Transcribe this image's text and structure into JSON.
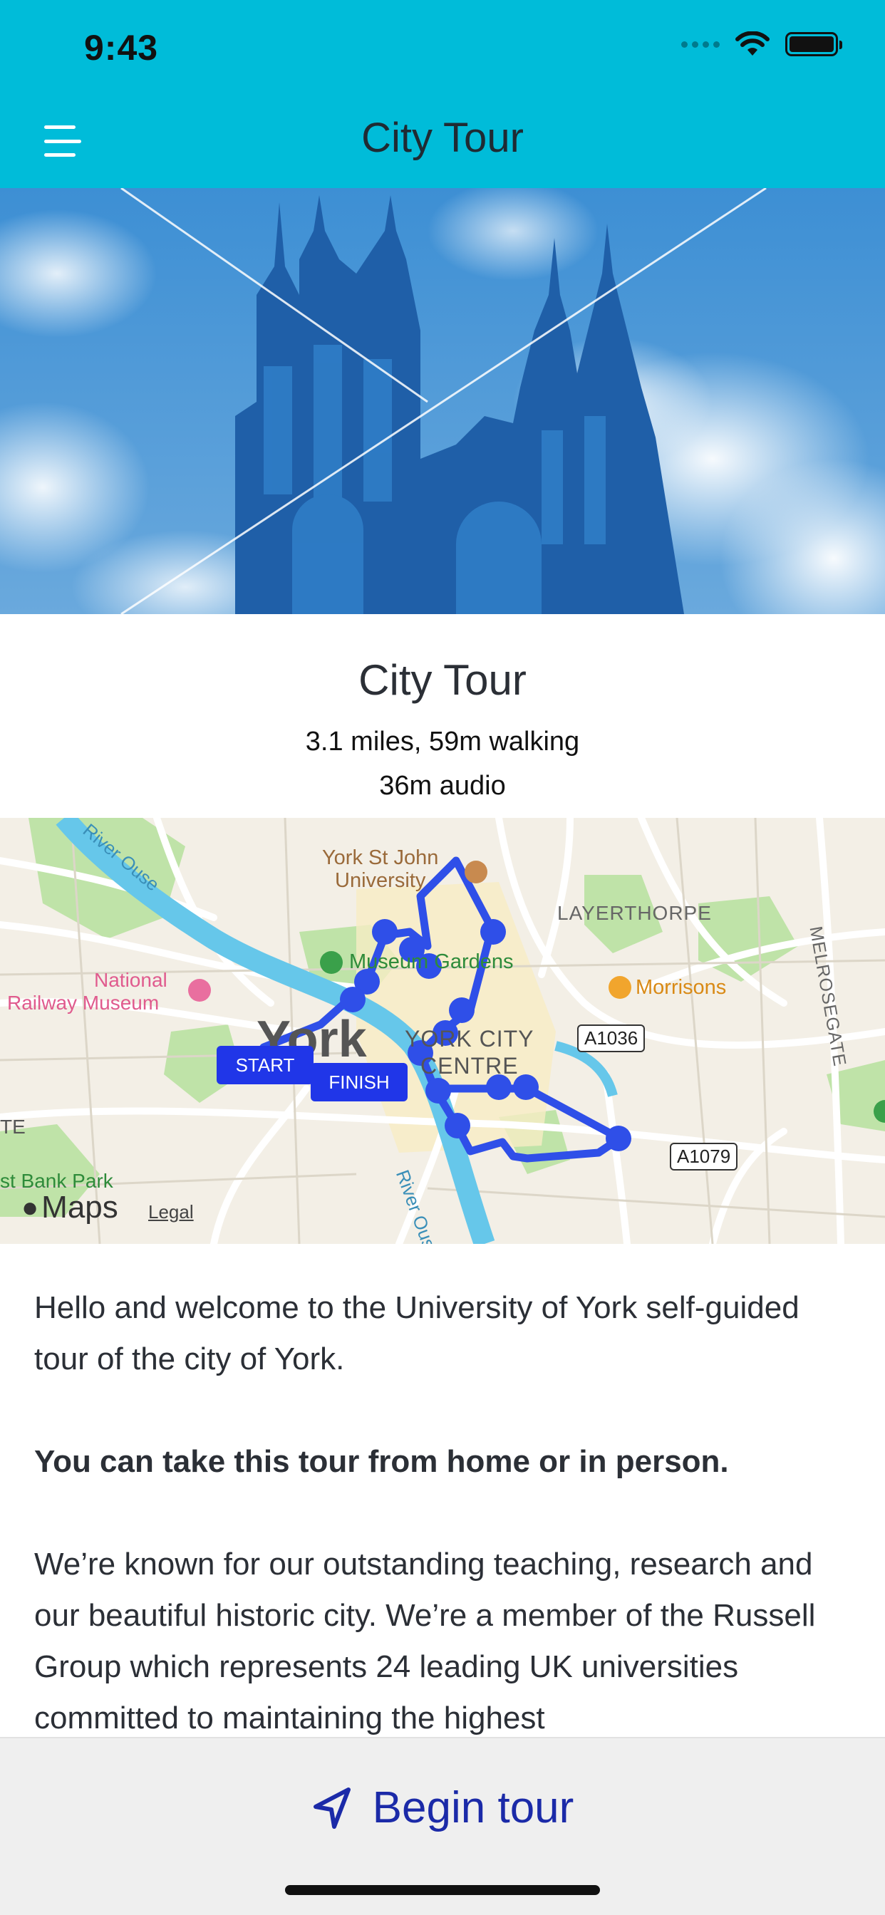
{
  "status_bar": {
    "time": "9:43"
  },
  "header": {
    "title": "City Tour",
    "menu_icon": "hamburger-menu-icon"
  },
  "hero": {
    "image": "york-minster-cathedral-photo",
    "tint": "#2a78c0"
  },
  "tour": {
    "title": "City Tour",
    "distance": "3.1 miles, 59m walking",
    "audio": "36m audio"
  },
  "map": {
    "labels": {
      "university": "York St John\nUniversity",
      "layerthorpe": "LAYERTHORPE",
      "museum_gardens": "Museum Gardens",
      "morrisons": "Morrisons",
      "railway_museum_1": "National",
      "railway_museum_2": "Railway Museum",
      "york": "York",
      "centre_1": "YORK CITY",
      "centre_2": "CENTRE",
      "a1036": "A1036",
      "a1079": "A1079",
      "river": "River Ouse",
      "river_nw": "River Ouse",
      "melrosegate": "MELROSEGATE",
      "bank_park": "st Bank Park",
      "maps": "Maps",
      "legal": "Legal",
      "edge_te": "TE"
    },
    "markers": {
      "start": "START",
      "finish": "FINISH"
    },
    "route_color": "#2f4fe8"
  },
  "content": {
    "intro": "Hello and welcome to the University of York self-guided tour of the city of York.",
    "highlight": "You can take this tour from home or in person.",
    "body": "We’re known for our outstanding teaching, research and our beautiful historic city. We’re a member of the Russell Group which represents 24 leading UK universities committed to maintaining the highest"
  },
  "action": {
    "label": "Begin tour",
    "icon": "navigation-arrow-icon"
  },
  "colors": {
    "header": "#00bcd9",
    "accent": "#1b2aa8"
  }
}
